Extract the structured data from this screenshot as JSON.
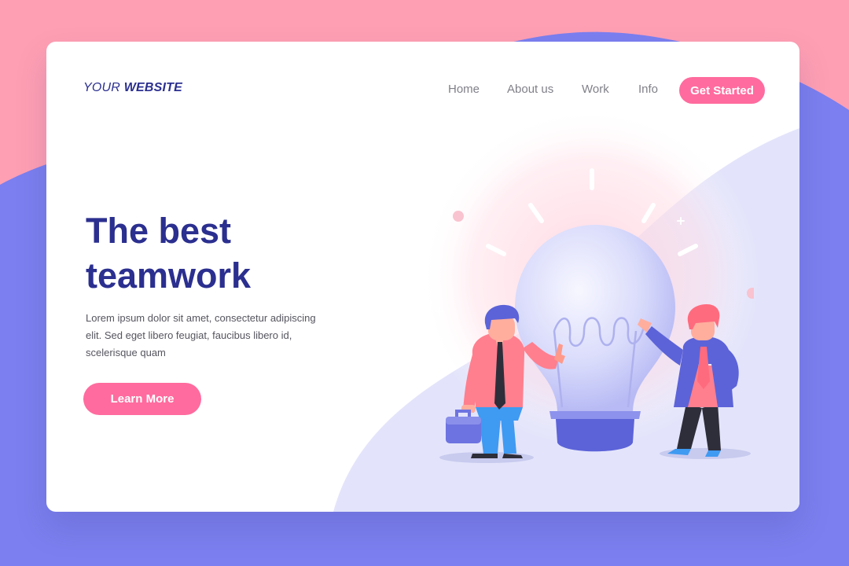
{
  "brand": {
    "part1": "YOUR",
    "part2": "WEBSITE"
  },
  "nav": {
    "items": [
      {
        "label": "Home"
      },
      {
        "label": "About us"
      },
      {
        "label": "Work"
      },
      {
        "label": "Info"
      }
    ],
    "cta_label": "Get Started"
  },
  "hero": {
    "title_line1": "The best",
    "title_line2": "teamwork",
    "text_line1": "Lorem ipsum dolor sit amet, consectetur adipiscing",
    "text_line2": "elit. Sed eget libero feugiat, faucibus libero id,",
    "text_line3": "scelerisque quam",
    "button_label": "Learn More"
  },
  "illustration": {
    "subject": "lightbulb-teamwork",
    "icons": [
      "lightbulb-icon",
      "person-left-icon",
      "person-right-icon",
      "briefcase-icon"
    ]
  },
  "colors": {
    "background_pink": "#FF9FB3",
    "background_purple": "#7B7FEF",
    "brand_navy": "#2B2F8F",
    "accent_pink": "#FF6B9E",
    "nav_gray": "#808089",
    "card_white": "#FFFFFF"
  }
}
